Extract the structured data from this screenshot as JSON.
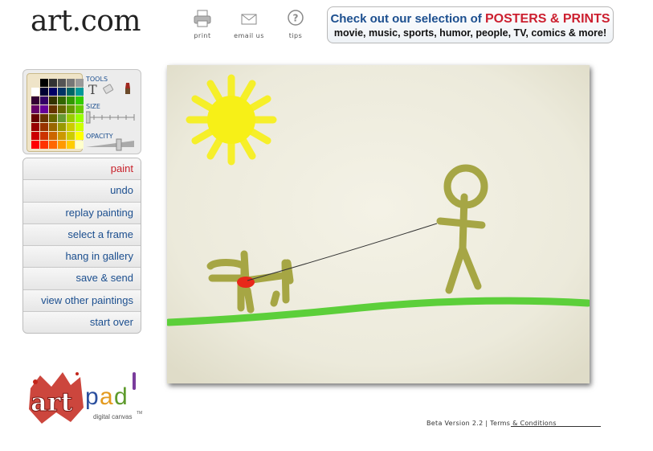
{
  "brand": {
    "logo_text": "art.com"
  },
  "top_icons": [
    {
      "icon": "printer-icon",
      "label": "print"
    },
    {
      "icon": "envelope-icon",
      "label": "email us"
    },
    {
      "icon": "question-icon",
      "label": "tips"
    }
  ],
  "promo": {
    "line1_prefix": "Check out our selection of",
    "line1_highlight": "POSTERS & PRINTS",
    "line2": "movie, music, sports, humor, people, TV, comics & more!"
  },
  "palette": {
    "tools_label": "TOOLS",
    "size_label": "SIZE",
    "opacity_label": "OPACITY",
    "colors": [
      "#ffffff",
      "#000000",
      "#333333",
      "#555555",
      "#777777",
      "#999999",
      "#ffffff",
      "#000033",
      "#000066",
      "#003366",
      "#006666",
      "#009999",
      "#330033",
      "#330066",
      "#333300",
      "#336600",
      "#339900",
      "#33cc00",
      "#660066",
      "#660099",
      "#663300",
      "#666600",
      "#669900",
      "#66cc00",
      "#660000",
      "#663300",
      "#666600",
      "#669933",
      "#99cc00",
      "#99ff00",
      "#990000",
      "#993300",
      "#996600",
      "#999900",
      "#cccc00",
      "#ccff00",
      "#cc0000",
      "#cc3300",
      "#cc6600",
      "#cc9900",
      "#cccc00",
      "#ffff00",
      "#ff0000",
      "#ff3300",
      "#ff6600",
      "#ff9900",
      "#ffcc00",
      "#ffffcc"
    ]
  },
  "menu": {
    "items": [
      {
        "label": "paint",
        "active": true
      },
      {
        "label": "undo"
      },
      {
        "label": "replay painting"
      },
      {
        "label": "select a frame"
      },
      {
        "label": "hang in gallery"
      },
      {
        "label": "save & send"
      },
      {
        "label": "view other paintings"
      },
      {
        "label": "start over"
      }
    ]
  },
  "canvas": {
    "colors": {
      "sun": "#f7f017",
      "ground": "#5ccf3a",
      "figure": "#9a9a2a",
      "collar": "#e8271a",
      "leash": "#333333"
    }
  },
  "artpad": {
    "word": "artpad",
    "tagline": "digital canvas",
    "tm": "TM"
  },
  "footer": {
    "version": "Beta Version 2.2",
    "separator": "|",
    "terms": "Terms & Conditions"
  }
}
